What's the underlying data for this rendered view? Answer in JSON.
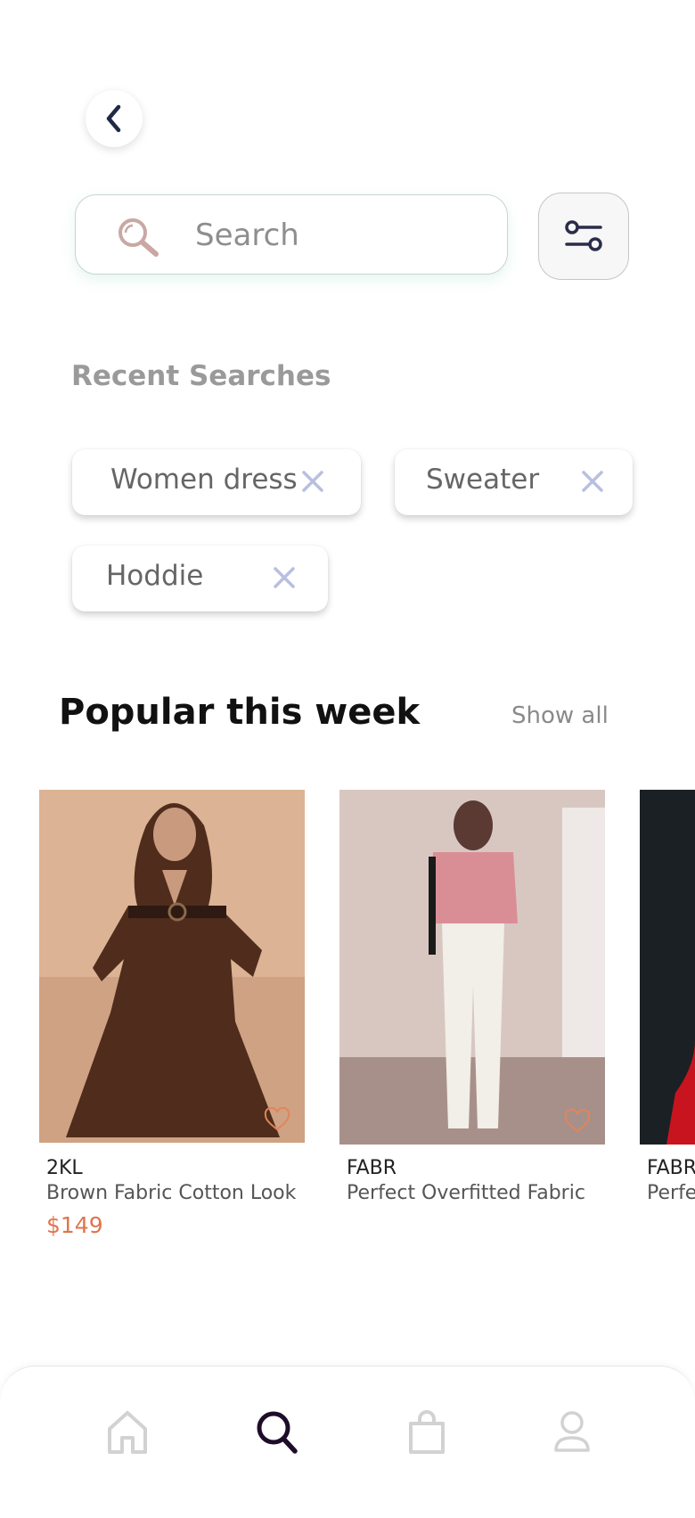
{
  "header": {
    "back_icon": "chevron-left-icon"
  },
  "search": {
    "placeholder": "Search",
    "icon": "search-icon",
    "filter_icon": "sliders-icon"
  },
  "recent": {
    "title": "Recent Searches",
    "chips": [
      {
        "label": "Women dress"
      },
      {
        "label": "Sweater"
      },
      {
        "label": "Hoddie"
      }
    ]
  },
  "popular": {
    "title": "Popular this week",
    "show_all": "Show all",
    "products": [
      {
        "brand": "2KL",
        "name": "Brown Fabric Cotton Look",
        "price": "$149"
      },
      {
        "brand": "FABR",
        "name": "Perfect Overfitted Fabric",
        "price": ""
      },
      {
        "brand": "FABR",
        "name": "Perfe",
        "price": ""
      }
    ]
  },
  "nav": {
    "items": [
      {
        "icon": "home-icon",
        "active": false
      },
      {
        "icon": "search-icon",
        "active": true
      },
      {
        "icon": "shopping-bag-icon",
        "active": false
      },
      {
        "icon": "profile-icon",
        "active": false
      }
    ]
  },
  "colors": {
    "accent": "#e0754c",
    "active_nav": "#1e0d2a",
    "inactive_nav": "#d2d2d2"
  }
}
